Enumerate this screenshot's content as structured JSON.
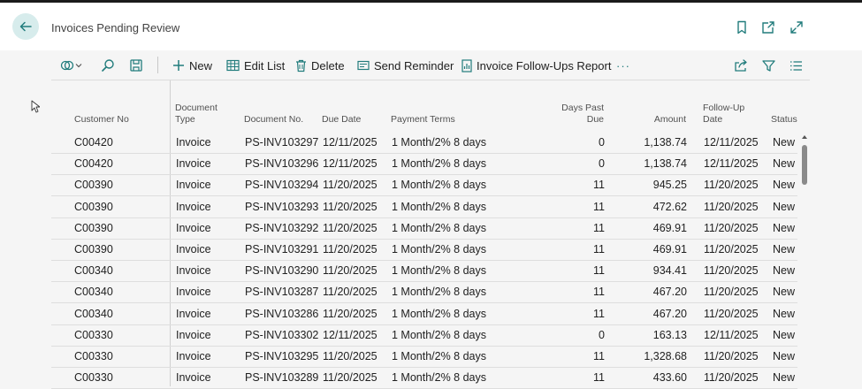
{
  "header": {
    "title": "Invoices Pending Review"
  },
  "toolbar": {
    "new_label": "New",
    "edit_list_label": "Edit List",
    "delete_label": "Delete",
    "send_reminder_label": "Send Reminder",
    "report_label": "Invoice Follow-Ups Report",
    "more_label": "···"
  },
  "columns": {
    "customer_no": "Customer No",
    "document_type_1": "Document",
    "document_type_2": "Type",
    "document_no": "Document No.",
    "due_date": "Due Date",
    "payment_terms": "Payment Terms",
    "days_past_due_1": "Days Past",
    "days_past_due_2": "Due",
    "amount": "Amount",
    "follow_up_1": "Follow-Up",
    "follow_up_2": "Date",
    "status": "Status"
  },
  "rows": [
    {
      "customer": "C00420",
      "type": "Invoice",
      "doc": "PS-INV103297",
      "due": "12/11/2025",
      "terms": "1 Month/2% 8 days",
      "days": "0",
      "amount": "1,138.74",
      "follow": "12/11/2025",
      "status": "New"
    },
    {
      "customer": "C00420",
      "type": "Invoice",
      "doc": "PS-INV103296",
      "due": "12/11/2025",
      "terms": "1 Month/2% 8 days",
      "days": "0",
      "amount": "1,138.74",
      "follow": "12/11/2025",
      "status": "New"
    },
    {
      "customer": "C00390",
      "type": "Invoice",
      "doc": "PS-INV103294",
      "due": "11/20/2025",
      "terms": "1 Month/2% 8 days",
      "days": "11",
      "amount": "945.25",
      "follow": "11/20/2025",
      "status": "New"
    },
    {
      "customer": "C00390",
      "type": "Invoice",
      "doc": "PS-INV103293",
      "due": "11/20/2025",
      "terms": "1 Month/2% 8 days",
      "days": "11",
      "amount": "472.62",
      "follow": "11/20/2025",
      "status": "New"
    },
    {
      "customer": "C00390",
      "type": "Invoice",
      "doc": "PS-INV103292",
      "due": "11/20/2025",
      "terms": "1 Month/2% 8 days",
      "days": "11",
      "amount": "469.91",
      "follow": "11/20/2025",
      "status": "New"
    },
    {
      "customer": "C00390",
      "type": "Invoice",
      "doc": "PS-INV103291",
      "due": "11/20/2025",
      "terms": "1 Month/2% 8 days",
      "days": "11",
      "amount": "469.91",
      "follow": "11/20/2025",
      "status": "New"
    },
    {
      "customer": "C00340",
      "type": "Invoice",
      "doc": "PS-INV103290",
      "due": "11/20/2025",
      "terms": "1 Month/2% 8 days",
      "days": "11",
      "amount": "934.41",
      "follow": "11/20/2025",
      "status": "New"
    },
    {
      "customer": "C00340",
      "type": "Invoice",
      "doc": "PS-INV103287",
      "due": "11/20/2025",
      "terms": "1 Month/2% 8 days",
      "days": "11",
      "amount": "467.20",
      "follow": "11/20/2025",
      "status": "New"
    },
    {
      "customer": "C00340",
      "type": "Invoice",
      "doc": "PS-INV103286",
      "due": "11/20/2025",
      "terms": "1 Month/2% 8 days",
      "days": "11",
      "amount": "467.20",
      "follow": "11/20/2025",
      "status": "New"
    },
    {
      "customer": "C00330",
      "type": "Invoice",
      "doc": "PS-INV103302",
      "due": "12/11/2025",
      "terms": "1 Month/2% 8 days",
      "days": "0",
      "amount": "163.13",
      "follow": "12/11/2025",
      "status": "New"
    },
    {
      "customer": "C00330",
      "type": "Invoice",
      "doc": "PS-INV103295",
      "due": "11/20/2025",
      "terms": "1 Month/2% 8 days",
      "days": "11",
      "amount": "1,328.68",
      "follow": "11/20/2025",
      "status": "New"
    },
    {
      "customer": "C00330",
      "type": "Invoice",
      "doc": "PS-INV103289",
      "due": "11/20/2025",
      "terms": "1 Month/2% 8 days",
      "days": "11",
      "amount": "433.60",
      "follow": "11/20/2025",
      "status": "New"
    }
  ],
  "colors": {
    "accent": "#217c7c",
    "back_bg": "#d7ecec",
    "icon": "#217c7c",
    "text": "#212121"
  },
  "icons": [
    "back-arrow-icon",
    "bookmark-icon",
    "open-new-window-icon",
    "expand-icon",
    "filter-views-icon",
    "search-icon",
    "save-view-icon",
    "plus-icon",
    "edit-list-icon",
    "trash-icon",
    "send-icon",
    "report-icon",
    "share-icon",
    "funnel-icon",
    "list-icon"
  ]
}
